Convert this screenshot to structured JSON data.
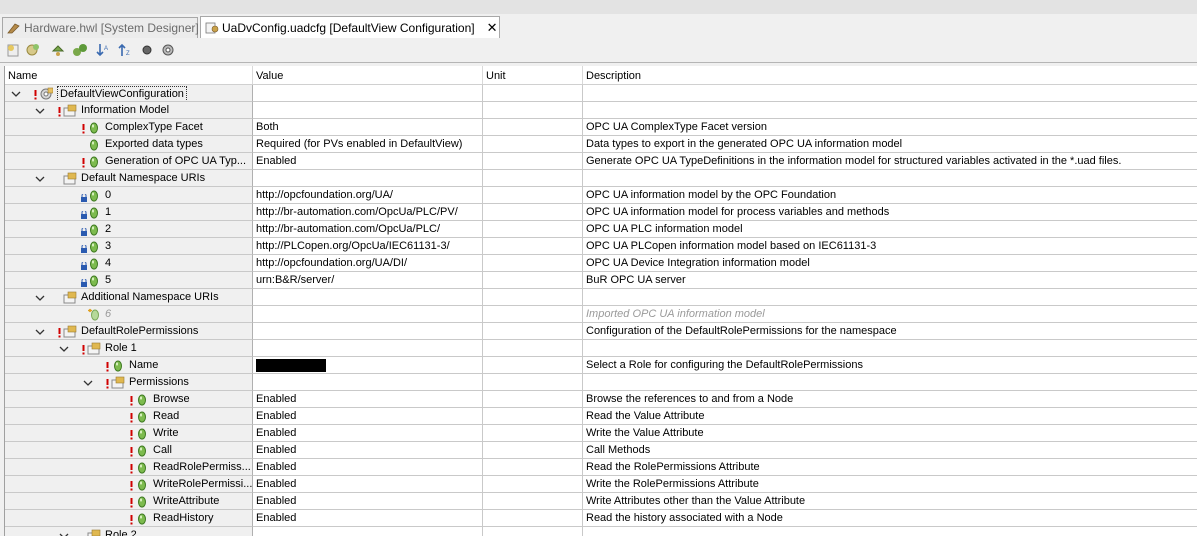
{
  "tabs": [
    {
      "label": "Hardware.hwl [System Designer]",
      "active": false
    },
    {
      "label": "UaDvConfig.uadcfg [DefaultView Configuration]",
      "active": true
    }
  ],
  "tab_close_glyph": "✕",
  "toolbar_icons": [
    "new-item-icon",
    "add-item-icon",
    "move-up-icon",
    "expand-all-icon",
    "sort-down-icon",
    "sort-up-icon",
    "record-icon",
    "settings-icon"
  ],
  "columns": {
    "name": "Name",
    "value": "Value",
    "unit": "Unit",
    "description": "Description"
  },
  "rows": [
    {
      "name": "DefaultViewConfiguration",
      "value": "",
      "unit": "",
      "desc": ""
    },
    {
      "name": "Information Model",
      "value": "",
      "unit": "",
      "desc": ""
    },
    {
      "name": "ComplexType Facet",
      "value": "Both",
      "unit": "",
      "desc": "OPC UA ComplexType Facet version"
    },
    {
      "name": "Exported data types",
      "value": "Required (for PVs enabled in DefaultView)",
      "unit": "",
      "desc": "Data types to export in the generated OPC UA information model"
    },
    {
      "name": "Generation of OPC UA Typ...",
      "value": "Enabled",
      "unit": "",
      "desc": "Generate OPC UA TypeDefinitions in the information model for structured variables activated in the *.uad files."
    },
    {
      "name": "Default Namespace URIs",
      "value": "",
      "unit": "",
      "desc": ""
    },
    {
      "name": "0",
      "value": "http://opcfoundation.org/UA/",
      "unit": "",
      "desc": "OPC UA information model by the OPC Foundation"
    },
    {
      "name": "1",
      "value": "http://br-automation.com/OpcUa/PLC/PV/",
      "unit": "",
      "desc": "OPC UA information model for process variables and methods"
    },
    {
      "name": "2",
      "value": "http://br-automation.com/OpcUa/PLC/",
      "unit": "",
      "desc": "OPC UA PLC information model"
    },
    {
      "name": "3",
      "value": "http://PLCopen.org/OpcUa/IEC61131-3/",
      "unit": "",
      "desc": "OPC UA PLCopen information model based on IEC61131-3"
    },
    {
      "name": "4",
      "value": "http://opcfoundation.org/UA/DI/",
      "unit": "",
      "desc": "OPC UA Device Integration information model"
    },
    {
      "name": "5",
      "value": "urn:B&R/server/",
      "unit": "",
      "desc": "BuR OPC UA server"
    },
    {
      "name": "Additional Namespace URIs",
      "value": "",
      "unit": "",
      "desc": ""
    },
    {
      "name": "6",
      "value": "",
      "unit": "",
      "desc": "Imported OPC UA information model"
    },
    {
      "name": "DefaultRolePermissions",
      "value": "",
      "unit": "",
      "desc": "Configuration of the DefaultRolePermissions for the namespace"
    },
    {
      "name": "Role 1",
      "value": "",
      "unit": "",
      "desc": ""
    },
    {
      "name": "Name",
      "value": "",
      "unit": "",
      "desc": "Select a Role for configuring the DefaultRolePermissions"
    },
    {
      "name": "Permissions",
      "value": "",
      "unit": "",
      "desc": ""
    },
    {
      "name": "Browse",
      "value": "Enabled",
      "unit": "",
      "desc": "Browse the references to and from a Node"
    },
    {
      "name": "Read",
      "value": "Enabled",
      "unit": "",
      "desc": "Read the Value Attribute"
    },
    {
      "name": "Write",
      "value": "Enabled",
      "unit": "",
      "desc": "Write the Value Attribute"
    },
    {
      "name": "Call",
      "value": "Enabled",
      "unit": "",
      "desc": "Call Methods"
    },
    {
      "name": "ReadRolePermiss...",
      "value": "Enabled",
      "unit": "",
      "desc": "Read the RolePermissions Attribute"
    },
    {
      "name": "WriteRolePermissi...",
      "value": "Enabled",
      "unit": "",
      "desc": "Write the RolePermissions Attribute"
    },
    {
      "name": "WriteAttribute",
      "value": "Enabled",
      "unit": "",
      "desc": "Write Attributes other than the Value Attribute"
    },
    {
      "name": "ReadHistory",
      "value": "Enabled",
      "unit": "",
      "desc": "Read the history associated with a Node"
    },
    {
      "name": "Role 2",
      "value": "",
      "unit": "",
      "desc": ""
    }
  ]
}
